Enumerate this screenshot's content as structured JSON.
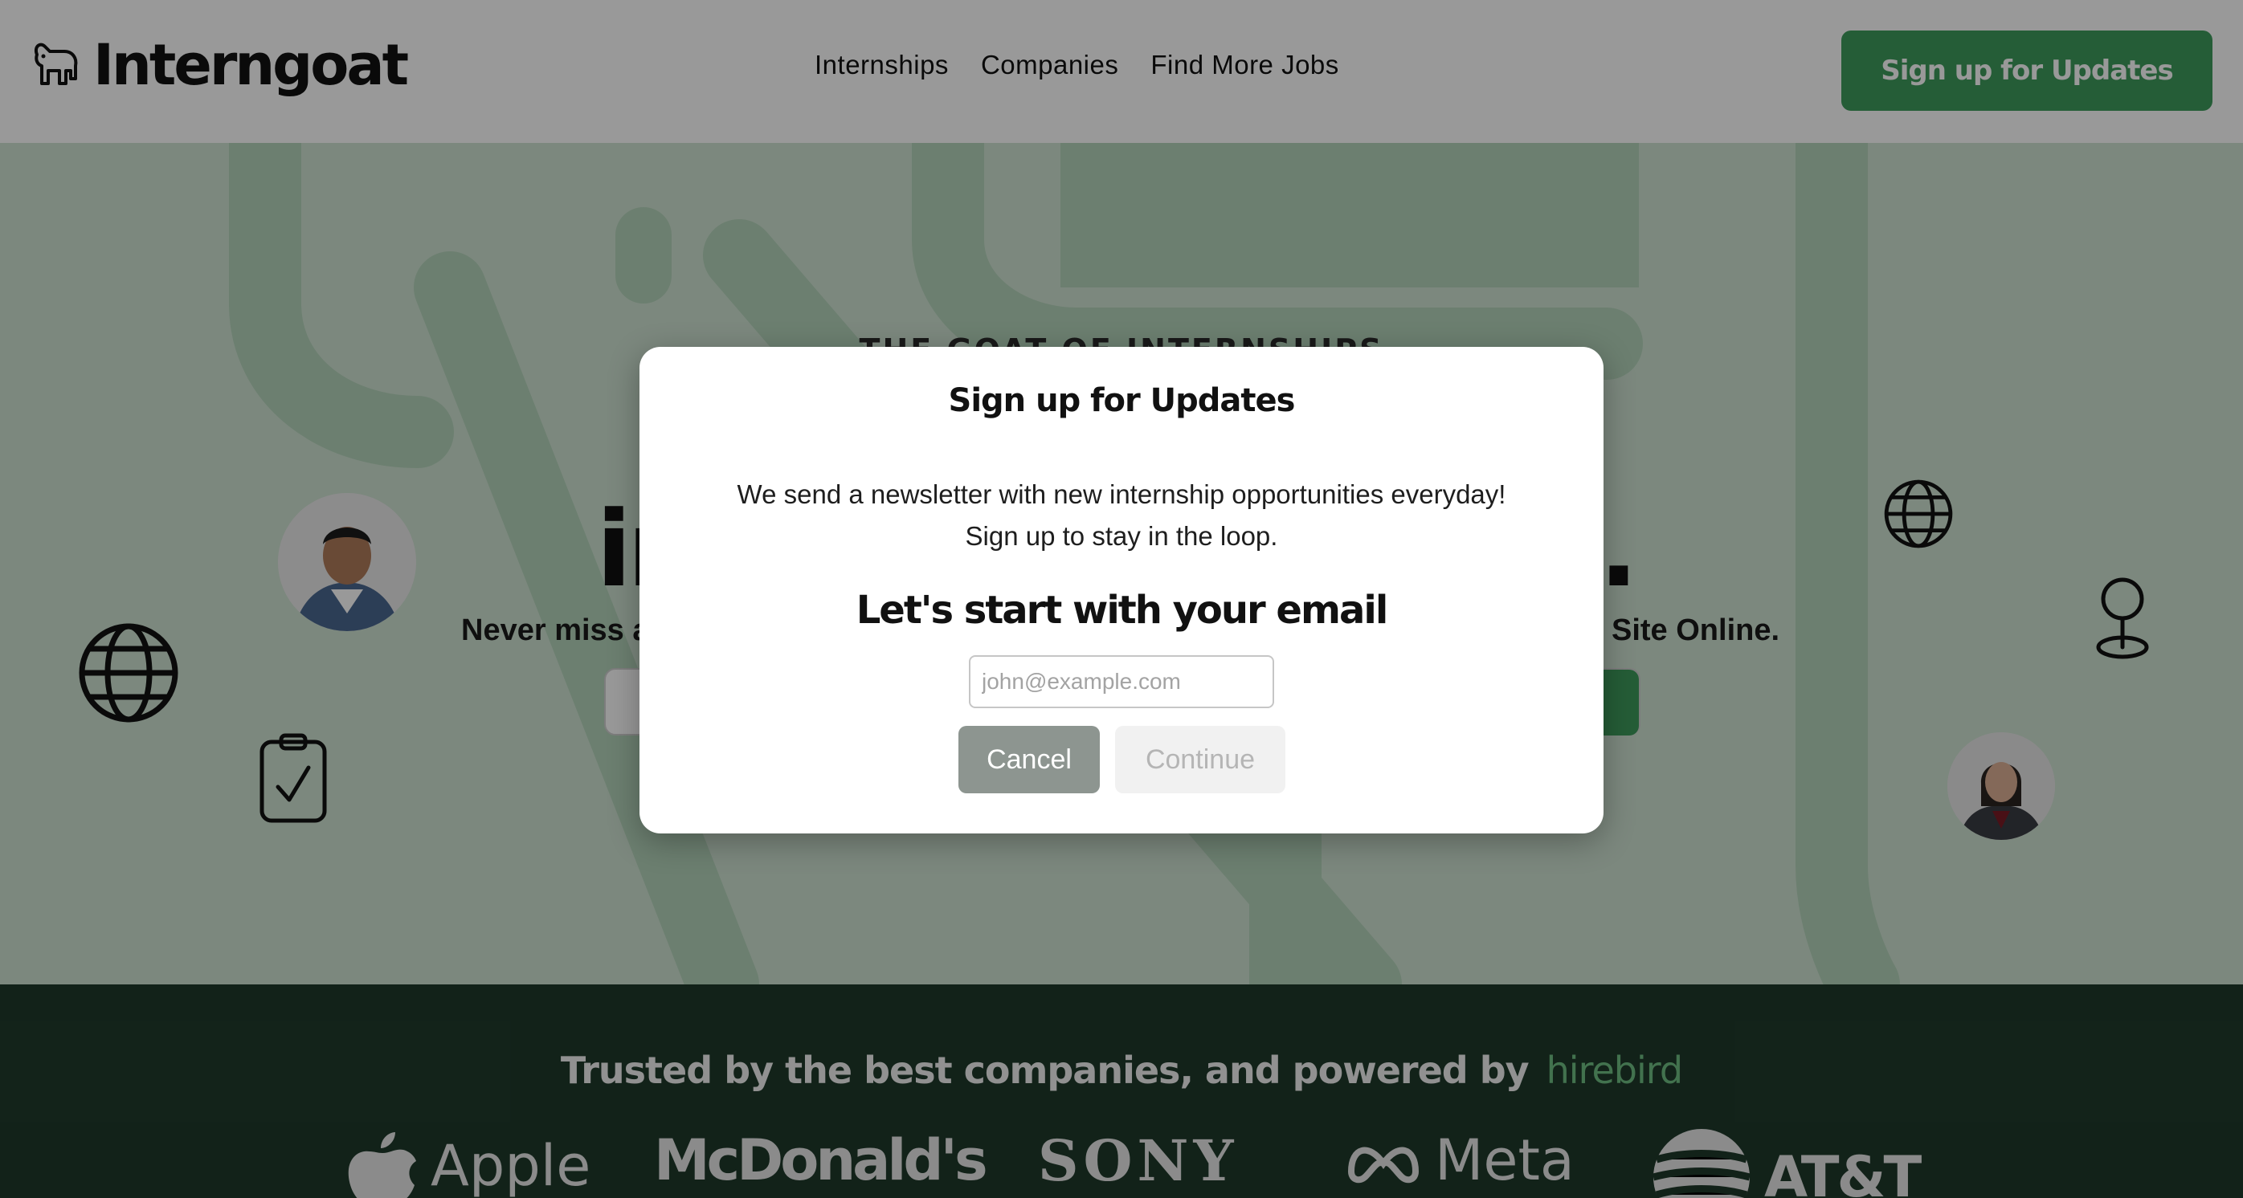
{
  "header": {
    "brand": "Interngoat",
    "nav": [
      "Internships",
      "Companies",
      "Find More Jobs"
    ],
    "cta_label": "Sign up for Updates"
  },
  "hero": {
    "kicker": "THE GOAT OF INTERNSHIPS",
    "title_left": "in",
    "title_right": "e.",
    "subtitle_left": "Never miss a",
    "subtitle_right": "Site Online.",
    "search_button_fragment": "v"
  },
  "trusted": {
    "text": "Trusted by the best companies, and powered by",
    "powered_brand": "hirebird",
    "companies": [
      "Apple",
      "McDonald's",
      "SONY",
      "Meta",
      "AT&T"
    ]
  },
  "modal": {
    "title": "Sign up for Updates",
    "description_line1": "We send a newsletter with new internship opportunities everyday!",
    "description_line2": "Sign up to stay in the loop.",
    "heading": "Let's start with your email",
    "email_placeholder": "john@example.com",
    "cancel_label": "Cancel",
    "continue_label": "Continue"
  },
  "colors": {
    "accent": "#3f9b5d",
    "hero_bg": "#cfe3d2",
    "band_bg": "#1f3a2b",
    "brand_green": "#6fbf82"
  },
  "icons": [
    "goat-logo-icon",
    "globe-icon",
    "clipboard-check-icon",
    "map-pin-icon",
    "apple-logo-icon",
    "meta-logo-icon",
    "att-logo-icon"
  ]
}
